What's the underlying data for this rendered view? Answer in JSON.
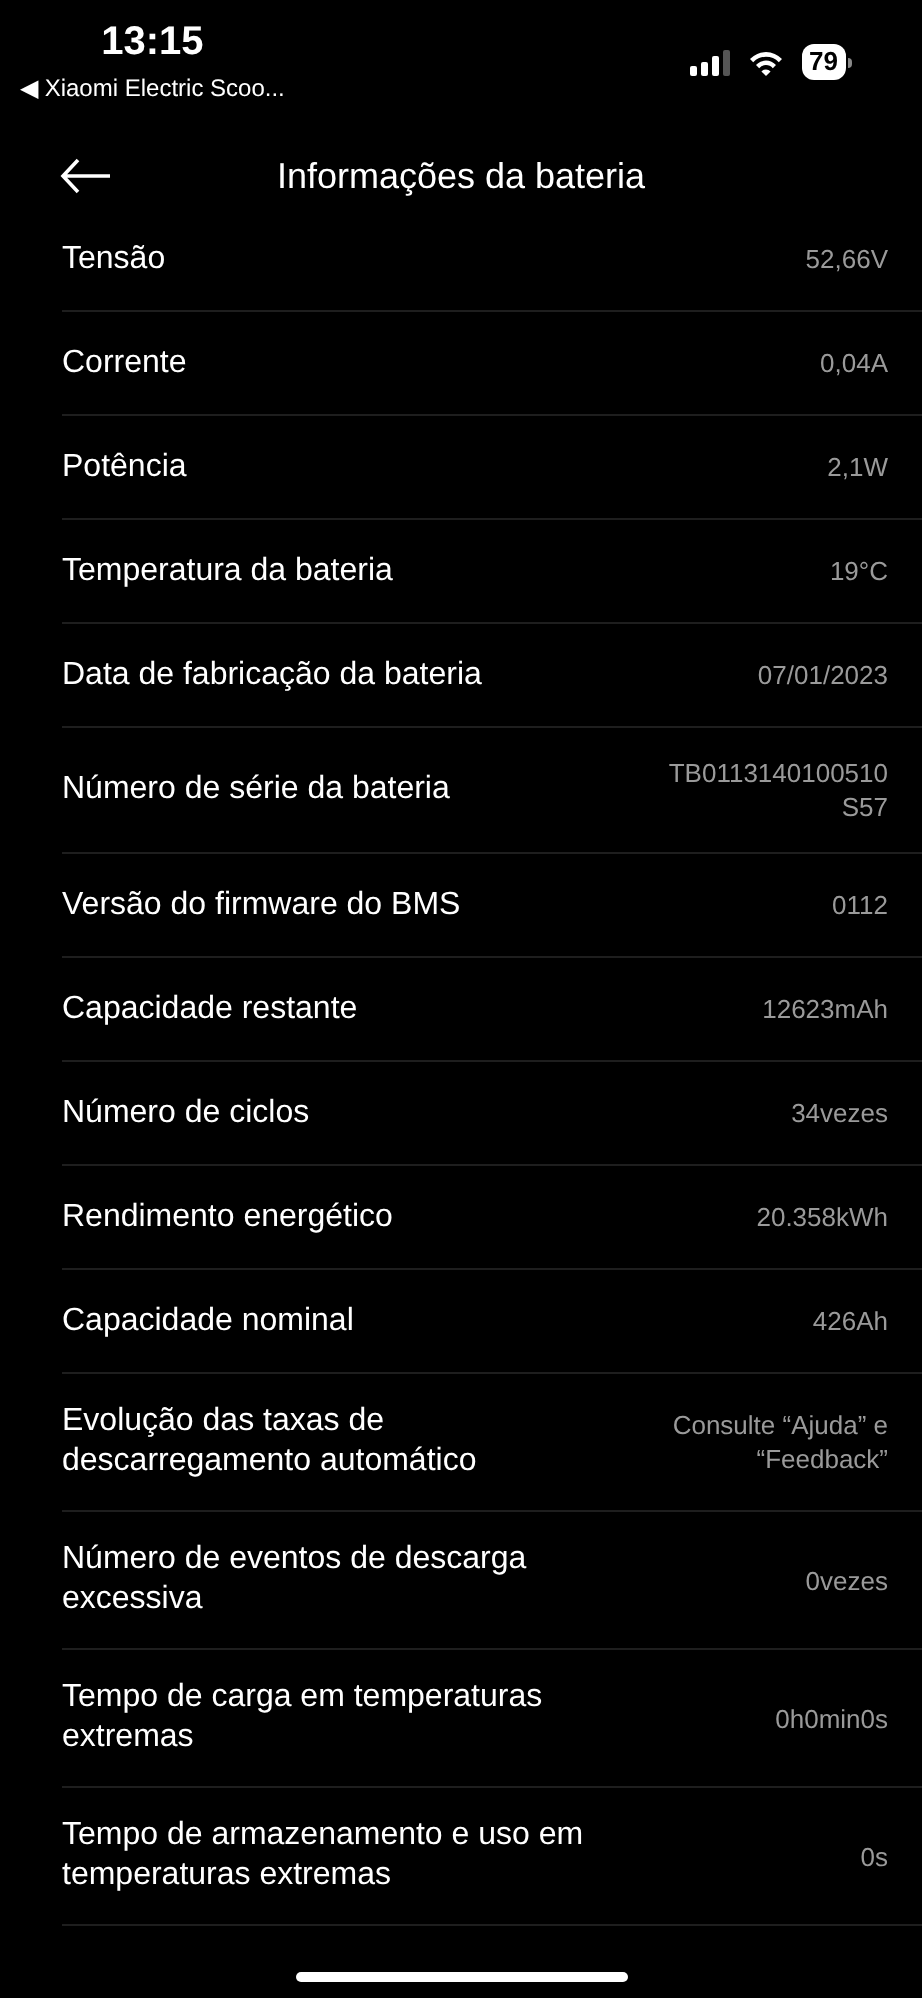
{
  "status_bar": {
    "time": "13:15",
    "back_app": "◀ Xiaomi Electric Scoo...",
    "battery": "79"
  },
  "header": {
    "title": "Informações da bateria"
  },
  "rows": [
    {
      "label": "Tensão",
      "value": "52,66V"
    },
    {
      "label": "Corrente",
      "value": "0,04A"
    },
    {
      "label": "Potência",
      "value": "2,1W"
    },
    {
      "label": "Temperatura da bateria",
      "value": "19°C"
    },
    {
      "label": "Data de fabricação da bateria",
      "value": "07/01/2023"
    },
    {
      "label": "Número de série da bateria",
      "value": "TB0113140100510 S57"
    },
    {
      "label": "Versão do firmware do BMS",
      "value": "0112"
    },
    {
      "label": "Capacidade restante",
      "value": "12623mAh"
    },
    {
      "label": "Número de ciclos",
      "value": "34vezes"
    },
    {
      "label": "Rendimento energético",
      "value": "20.358kWh"
    },
    {
      "label": "Capacidade nominal",
      "value": "426Ah"
    },
    {
      "label": "Evolução das taxas de descarregamento automático",
      "value": "Consulte “Ajuda” e “Feedback”"
    },
    {
      "label": "Número de eventos de descarga excessiva",
      "value": "0vezes"
    },
    {
      "label": "Tempo de carga em temperaturas extremas",
      "value": "0h0min0s"
    },
    {
      "label": "Tempo de armazenamento e uso em temperaturas extremas",
      "value": "0s"
    }
  ]
}
